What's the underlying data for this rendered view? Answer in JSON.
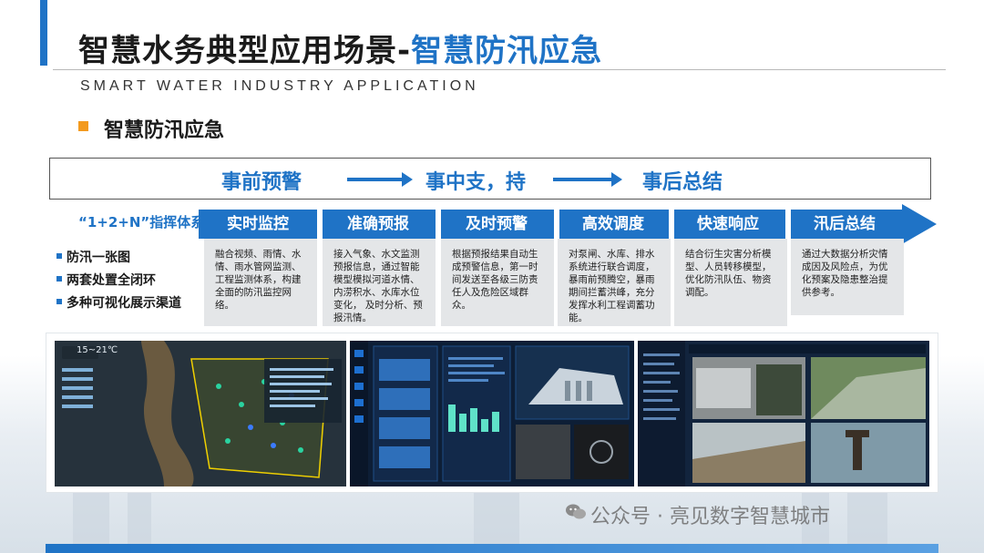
{
  "header": {
    "title_main": "智慧水务典型应用场景-",
    "title_accent": "智慧防汛应急",
    "subtitle": "SMART WATER INDUSTRY APPLICATION"
  },
  "section": {
    "heading": "智慧防汛应急"
  },
  "phases": {
    "before": "事前预警",
    "during": "事中支，持",
    "after": "事后总结"
  },
  "command_system": {
    "title": "“1+2+N”指挥体系",
    "features": [
      "防汛一张图",
      "两套处置全闭环",
      "多种可视化展示渠道"
    ]
  },
  "steps": [
    {
      "title": "实时监控",
      "desc": "融合视频、雨情、水情、雨水管网监测、工程监测体系，构建全面的防汛监控网络。"
    },
    {
      "title": "准确预报",
      "desc": "接入气象、水文监测预报信息，通过智能模型模拟河道水情、内涝积水、水库水位变化， 及时分析、预报汛情。"
    },
    {
      "title": "及时预警",
      "desc": "根据预报结果自动生成预警信息，第一时间发送至各级三防责任人及危险区域群众。"
    },
    {
      "title": "高效调度",
      "desc": "对泵闸、水库、排水系统进行联合调度，暴雨前预腾空，暴雨期间拦蓄洪峰，充分发挥水利工程调蓄功能。"
    },
    {
      "title": "快速响应",
      "desc": "结合衍生灾害分析模型、人员转移模型，优化防汛队伍、物资调配。"
    },
    {
      "title": "汛后总结",
      "desc": "通过大数据分析灾情成因及风险点，为优化预案及隐患整治提供参考。"
    }
  ],
  "screens": {
    "map_weather": "15~21℃"
  },
  "watermark": "公众号 · 亮见数字智慧城市",
  "colors": {
    "accent_blue": "#1f73c6",
    "bullet_orange": "#f39a1e",
    "card_gray": "#e4e6e8"
  }
}
